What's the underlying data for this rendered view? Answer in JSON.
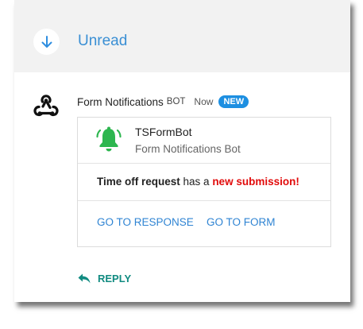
{
  "header": {
    "title": "Unread",
    "collapse_icon": "arrow-down-icon"
  },
  "message": {
    "sender": "Form Notifications",
    "bot_tag": "BOT",
    "time": "Now",
    "badge": "NEW",
    "avatar_icon": "webhook-icon"
  },
  "card": {
    "bot_name": "TSFormBot",
    "bot_subtitle": "Form Notifications Bot",
    "bell_icon": "bell-icon",
    "text_bold": "Time off request",
    "text_plain": " has a ",
    "text_highlight": "new submission!",
    "actions": [
      "GO TO RESPONSE",
      "GO TO FORM"
    ]
  },
  "reply": {
    "label": "REPLY",
    "icon": "reply-arrow-icon"
  },
  "colors": {
    "accent_blue": "#3a8fd4",
    "badge_blue": "#1d8fe1",
    "bell_green": "#2db64f",
    "highlight_red": "#e10b0b",
    "reply_teal": "#118b81",
    "header_bg": "#f2f2f2"
  }
}
